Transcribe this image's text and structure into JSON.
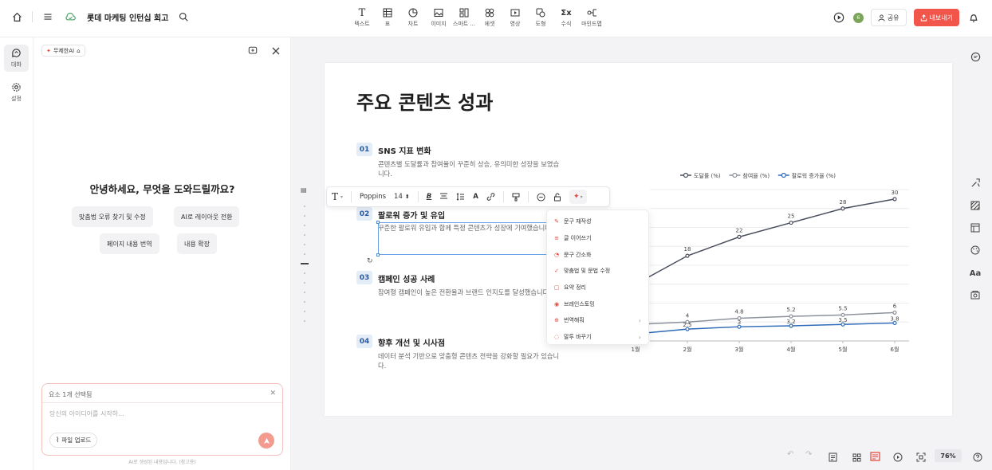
{
  "header": {
    "doc_title": "롯데 마케팅 인턴십 회고",
    "tools": [
      "텍스트",
      "표",
      "차트",
      "이미지",
      "스마트 ...",
      "에셋",
      "영상",
      "도형",
      "수식",
      "마인드맵"
    ],
    "share_label": "공유",
    "export_label": "내보내기",
    "avatar_initial": "6"
  },
  "rail": {
    "chat_label": "대화",
    "settings_label": "설정"
  },
  "panel": {
    "ai_chip": "무제한AI",
    "greeting": "안녕하세요, 무엇을 도와드릴까요?",
    "suggestions": [
      "맞춤법 오류 찾기 및 수정",
      "AI로 레이아웃 전환",
      "페이지 내용 번역",
      "내용 확장"
    ],
    "selected_label": "요소 1개 선택됨",
    "placeholder": "당신의 아이디어를 시작하...",
    "upload_label": "파일 업로드",
    "disclaimer": "AI로 생성된 내용입니다. (참고용)"
  },
  "slide": {
    "title": "주요 콘텐츠 성과",
    "sections": [
      {
        "num": "01",
        "title": "SNS 지표 변화",
        "desc": "콘텐츠별 도달률과 참여율이 꾸준히 상승, 유의미한 성장을 보였습니다."
      },
      {
        "num": "02",
        "title": "팔로워 증가 및 유입",
        "desc": "꾸준한 팔로워 유입과 함께 특정 콘텐츠가 성장에 기여했습니다."
      },
      {
        "num": "03",
        "title": "캠페인 성공 사례",
        "desc": "참여형 캠페인이 높은 전환율과 브랜드 인지도를 달성했습니다."
      },
      {
        "num": "04",
        "title": "향후 개선 및 시사점",
        "desc": "데이터 분석 기반으로 맞춤형 콘텐츠 전략을 강화할 필요가 있습니다."
      }
    ]
  },
  "format_toolbar": {
    "font": "Poppins",
    "size": "14"
  },
  "ai_menu": {
    "items": [
      {
        "label": "문구 재작성",
        "has_submenu": false
      },
      {
        "label": "글 이어쓰기",
        "has_submenu": false
      },
      {
        "label": "문구 간소화",
        "has_submenu": false
      },
      {
        "label": "맞춤법 및 문법 수정",
        "has_submenu": false
      },
      {
        "label": "요약 정리",
        "has_submenu": false
      },
      {
        "label": "브레인스토밍",
        "has_submenu": false
      },
      {
        "label": "번역해줘",
        "has_submenu": true
      },
      {
        "label": "말투 바꾸기",
        "has_submenu": true
      }
    ]
  },
  "chart_data": {
    "type": "line",
    "categories": [
      "1월",
      "2월",
      "3월",
      "4월",
      "5월",
      "6월"
    ],
    "series": [
      {
        "name": "도달률 (%)",
        "values": [
          12,
          18,
          22,
          25,
          28,
          30
        ],
        "color": "#4a4f5e",
        "labels": [
          "",
          "18",
          "22",
          "25",
          "28",
          "30"
        ]
      },
      {
        "name": "참여율 (%)",
        "values": [
          3.5,
          4,
          4.8,
          5.2,
          5.5,
          6
        ],
        "color": "#8d929d",
        "labels": [
          "",
          "4",
          "4.8",
          "5.2",
          "5.5",
          "6"
        ]
      },
      {
        "name": "팔로워 증가율 (%)",
        "values": [
          1.5,
          2.5,
          3,
          3.2,
          3.5,
          3.8
        ],
        "color": "#2f6bb8",
        "labels": [
          "",
          "2.5",
          "3",
          "3.2",
          "3.5",
          "3.8"
        ]
      }
    ],
    "ylim": [
      0,
      32
    ],
    "grid": true,
    "legend": "top"
  },
  "bottom": {
    "zoom": "76%"
  },
  "colors": {
    "accent": "#f2554a",
    "selection": "#6ba3e8"
  }
}
